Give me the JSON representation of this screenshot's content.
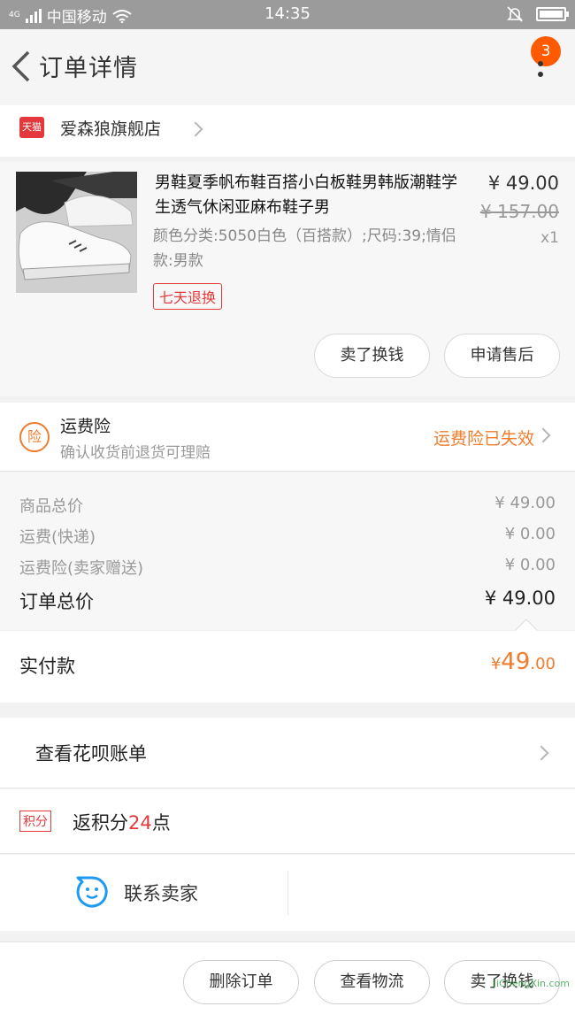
{
  "status_bar": {
    "signal": "4G",
    "carrier": "中国移动",
    "time": "14:35"
  },
  "header": {
    "title": "订单详情",
    "badge_count": "3"
  },
  "shop": {
    "platform_tag": "天猫",
    "name": "爱森狼旗舰店"
  },
  "product": {
    "title": "男鞋夏季帆布鞋百搭小白板鞋男韩版潮鞋学生透气休闲亚麻布鞋子男",
    "sku": "颜色分类:5050白色（百搭款）;尺码:39;情侣款:男款",
    "service_tag": "七天退换",
    "price": "¥ 49.00",
    "original_price": "¥ 157.00",
    "quantity": "x1",
    "btn_sell": "卖了换钱",
    "btn_aftersale": "申请售后"
  },
  "insurance": {
    "icon_text": "险",
    "title": "运费险",
    "subtitle": "确认收货前退货可理赔",
    "status": "运费险已失效"
  },
  "summary": {
    "rows": [
      {
        "label": "商品总价",
        "value": "¥ 49.00"
      },
      {
        "label": "运费(快递)",
        "value": "¥ 0.00"
      },
      {
        "label": "运费险(卖家赠送)",
        "value": "¥ 0.00"
      }
    ],
    "total_label": "订单总价",
    "total_value": "¥ 49.00"
  },
  "paid": {
    "label": "实付款",
    "currency": "¥",
    "integer": "49",
    "decimal": ".00"
  },
  "huabei": {
    "label": "查看花呗账单"
  },
  "points": {
    "tag": "积分",
    "prefix": "返积分",
    "value": "24",
    "suffix": "点"
  },
  "contact": {
    "label": "联系卖家"
  },
  "bottom_actions": {
    "delete": "删除订单",
    "logistics": "查看物流",
    "sell": "卖了换钱"
  },
  "watermark": "JiChengXin.com",
  "colors": {
    "accent_orange": "#f07c2d",
    "tmall_red": "#e4393c",
    "badge_orange": "#ff5a00",
    "status_bar": "#9b9b9b"
  }
}
